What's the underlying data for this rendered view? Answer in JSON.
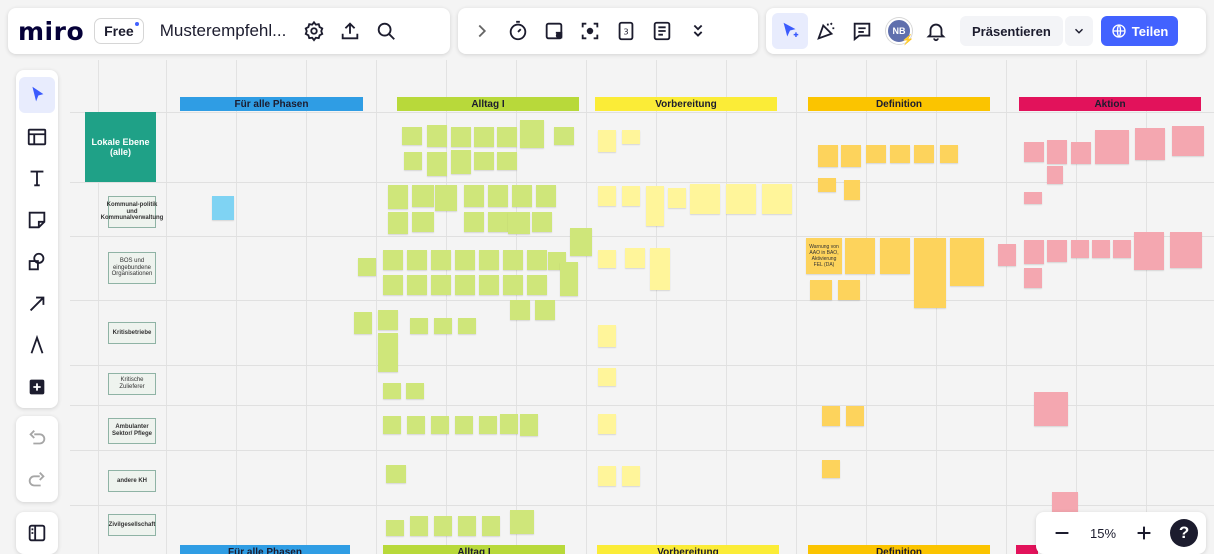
{
  "app": {
    "logo": "miro",
    "plan": "Free",
    "board_title": "Musterempfehl..."
  },
  "header": {
    "present_label": "Präsentieren",
    "share_label": "Teilen",
    "avatar_initials": "NB"
  },
  "zoom": {
    "level": "15%"
  },
  "phases": {
    "top": [
      "Für alle Phasen",
      "Alltag I",
      "Vorbereitung",
      "Definition",
      "Aktion"
    ],
    "bottom": [
      "Für alle Phasen",
      "Alltag I",
      "Vorbereitung",
      "Definition",
      ""
    ]
  },
  "phase_colors": {
    "all": "#2f9de4",
    "alltag": "#b8d93a",
    "vorbereitung": "#fbec37",
    "definition": "#fbc400",
    "aktion": "#e2125b"
  },
  "rows": {
    "lokale": "Lokale Ebene (alle)",
    "kommunal": "Kommunal-politik und Kommunalverwaltung",
    "bos": "BOS und eingebundene Organisationen",
    "kritis": "Kritisbetriebe",
    "zulieferer": "Kritische Zulieferer",
    "ambulant": "Ambulanter Sektor/ Pflege",
    "andere": "andere KH",
    "zivil": "Zivilgesellschaft"
  },
  "notes": {
    "warnung": "Warnung von AAO in BAO, Aktivierung FEL (DA)"
  },
  "icons": {
    "settings": "settings-icon",
    "upload": "upload-icon",
    "search": "search-icon",
    "chevron": "chevron-right-icon",
    "timer": "timer-icon",
    "card": "card-icon",
    "focus": "focus-icon",
    "count": "count-icon",
    "notes": "notes-icon",
    "more": "more-icon",
    "cursor": "cursor-icon",
    "celebrate": "celebrate-icon",
    "comment": "comment-icon",
    "bell": "bell-icon",
    "globe": "globe-icon"
  }
}
